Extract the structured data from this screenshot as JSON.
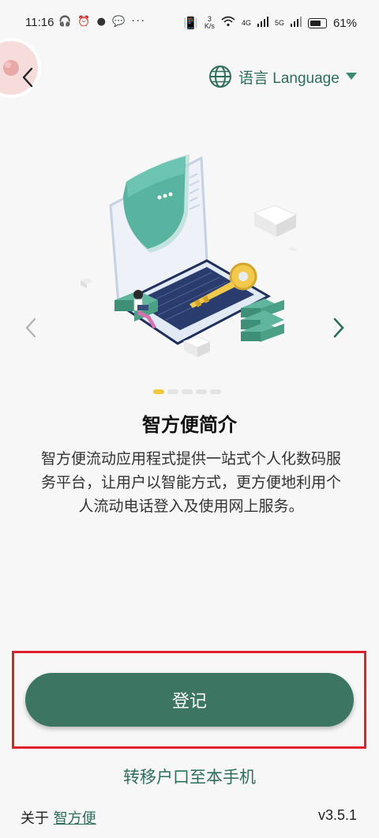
{
  "status_bar": {
    "time": "11:16",
    "net_speed_value": "3",
    "net_speed_unit": "K/s",
    "signal_1": "4G",
    "signal_2": "5G",
    "battery": "61%",
    "battery_level": 0.61
  },
  "header": {
    "language_label": "语言 Language"
  },
  "intro": {
    "title": "智方便简介",
    "description": "智方便流动应用程式提供一站式个人化数码服务平台，让用户以智能方式，更方便地利用个人流动电话登入及使用网上服务。"
  },
  "carousel": {
    "pages": 5,
    "active_index": 0
  },
  "actions": {
    "register_label": "登记",
    "transfer_label": "转移户口至本手机"
  },
  "footer": {
    "about_prefix": "关于",
    "about_link": "智方便",
    "version": "v3.5.1"
  },
  "colors": {
    "brand": "#3c7663",
    "accent_text": "#2e6e5c",
    "highlight": "#e0212b",
    "dot_active": "#f0c83c"
  }
}
